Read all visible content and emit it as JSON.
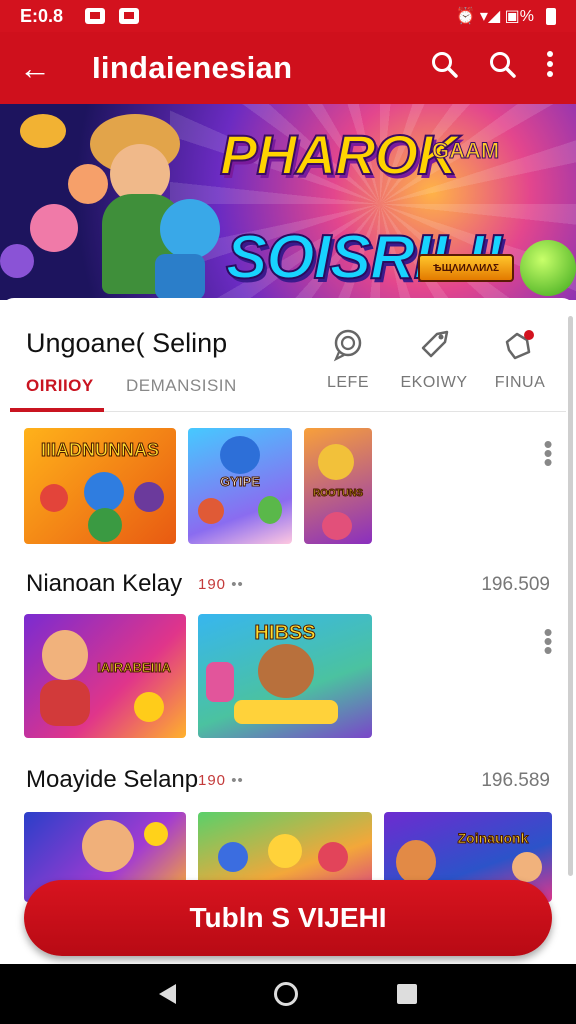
{
  "status_bar": {
    "time": "E:0.8",
    "right_text": "⏰ ▾◢ ▣%"
  },
  "app_bar": {
    "title": "Iindaienesian"
  },
  "banner": {
    "line1": "PHAROK",
    "line1_small": "GAAM",
    "line2": "SOISRILI!",
    "ribbon": "ѢЩΛИΛΛИΛΣ"
  },
  "section": {
    "title": "Ungoane( Selinp",
    "tabs": [
      "OIRIIOY",
      "DEMANSISIN"
    ],
    "quick_actions": [
      {
        "icon": "chat-search-icon",
        "label": "LEFE"
      },
      {
        "icon": "tag-icon",
        "label": "EKOIWY"
      },
      {
        "icon": "cart-icon",
        "label": "FINUA"
      }
    ]
  },
  "rows": [
    {
      "thumbs": [
        "IIIADNUNNAS",
        "GYIPE",
        "ROOTUNS"
      ]
    },
    {
      "title": "Nianoan Kelay",
      "sub": "190",
      "count": "196.509",
      "thumbs": [
        "IAIRABEIIIA",
        "HIBSS"
      ]
    },
    {
      "title": "Moayide Selanp",
      "sub": "190",
      "count": "196.589",
      "thumbs": [
        "",
        "",
        "Zoinauonk"
      ]
    }
  ],
  "cta": {
    "label": "Tubln S VIJEHI"
  },
  "colors": {
    "brand_red": "#cf101c",
    "accent_red": "#c91420"
  }
}
